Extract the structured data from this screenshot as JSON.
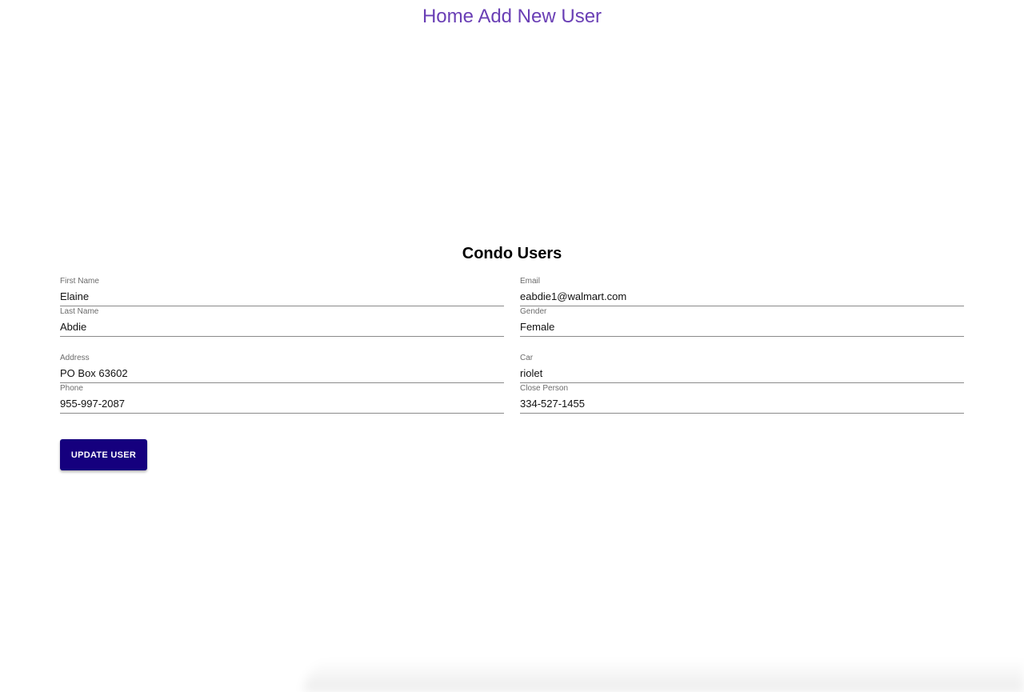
{
  "nav": {
    "home_label": "Home",
    "add_user_label": "Add New User"
  },
  "form": {
    "title": "Condo Users",
    "fields": {
      "first_name": {
        "label": "First Name",
        "value": "Elaine"
      },
      "email": {
        "label": "Email",
        "value": "eabdie1@walmart.com"
      },
      "last_name": {
        "label": "Last Name",
        "value": "Abdie"
      },
      "gender": {
        "label": "Gender",
        "value": "Female"
      },
      "address": {
        "label": "Address",
        "value": "PO Box 63602"
      },
      "car": {
        "label": "Car",
        "value": "riolet"
      },
      "phone": {
        "label": "Phone",
        "value": "955-997-2087"
      },
      "close_person": {
        "label": "Close Person",
        "value": "334-527-1455"
      }
    },
    "submit_label": "Update User"
  },
  "colors": {
    "nav_link": "#6a3fb5",
    "button_bg": "#15007e",
    "button_text": "#ffffff"
  }
}
